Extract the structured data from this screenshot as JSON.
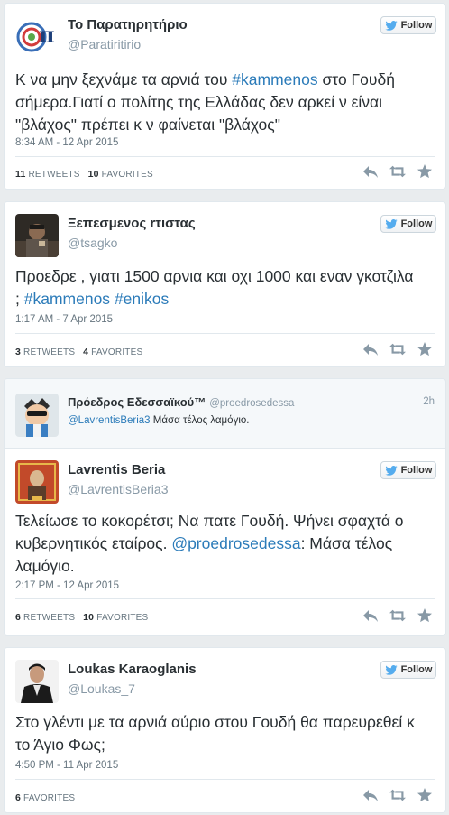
{
  "follow_label": "Follow",
  "tweets": [
    {
      "name": "Το Παρατηρητήριο",
      "handle": "@Paratiritirio_",
      "text": [
        [
          "Κ να μην ξεχνάμε τα αρνιά του ",
          "#kammenos",
          " στο Γουδή"
        ],
        [
          "σήμερα.Γιατί ο πολίτης της Ελλάδας δεν αρκεί ν είναι",
          "",
          ""
        ],
        [
          "\"βλάχος\" πρέπει κ ν φαίνεται \"βλάχος\"",
          "",
          ""
        ]
      ],
      "timestamp": "8:34 AM - 12 Apr 2015",
      "retweets": "11",
      "retweets_label": "RETWEETS",
      "favorites": "10",
      "favorites_label": "FAVORITES"
    },
    {
      "name": "Ξεπεσμενος rτιστας",
      "handle": "@tsagko",
      "text_l1": "Προεδρε , γιατι 1500 αρνια και οχι 1000 και εναν γκοτζιλα",
      "text_l2_pre": "; ",
      "tag1": "#kammenos",
      "tag2": "#enikos",
      "timestamp": "1:17 AM - 7 Apr 2015",
      "retweets": "3",
      "retweets_label": "RETWEETS",
      "favorites": "4",
      "favorites_label": "FAVORITES"
    },
    {
      "name": "Lavrentis Beria",
      "handle": "@LavrentisBeria3",
      "text_l1": "Τελείωσε το κοκορέτσι; Να πατε Γουδή. Ψήνει σφαχτά ο",
      "text_l2_pre": "κυβερνητικός εταίρος. ",
      "mention": "@proedrosedessa",
      "text_l2_post": ": Μάσα τέλος",
      "text_l3": "λαμόγιο.",
      "timestamp": "2:17 PM - 12 Apr 2015",
      "retweets": "6",
      "retweets_label": "RETWEETS",
      "favorites": "10",
      "favorites_label": "FAVORITES",
      "in_reply_to": {
        "name": "Πρόεδρος Εδεσσαϊκού™",
        "handle": "@proedrosedessa",
        "time": "2h",
        "mention": "@LavrentisBeria3",
        "text": " Μάσα τέλος λαμόγιο."
      }
    },
    {
      "name": "Loukas Karaoglanis",
      "handle": "@Loukas_7",
      "text_l1": "Στο γλέντι με τα αρνιά αύριο στου Γουδή θα παρευρεθεί κ",
      "text_l2": "το Άγιο Φως;",
      "timestamp": "4:50 PM - 11 Apr 2015",
      "favorites": "6",
      "favorites_label": "FAVORITES"
    }
  ],
  "icons": {
    "reply": "reply-icon",
    "retweet": "retweet-icon",
    "favorite": "star-icon",
    "bird": "twitter-bird-icon"
  },
  "colors": {
    "link": "#2b7bb9",
    "muted": "#66757f",
    "follow_bird": "#55acee"
  }
}
